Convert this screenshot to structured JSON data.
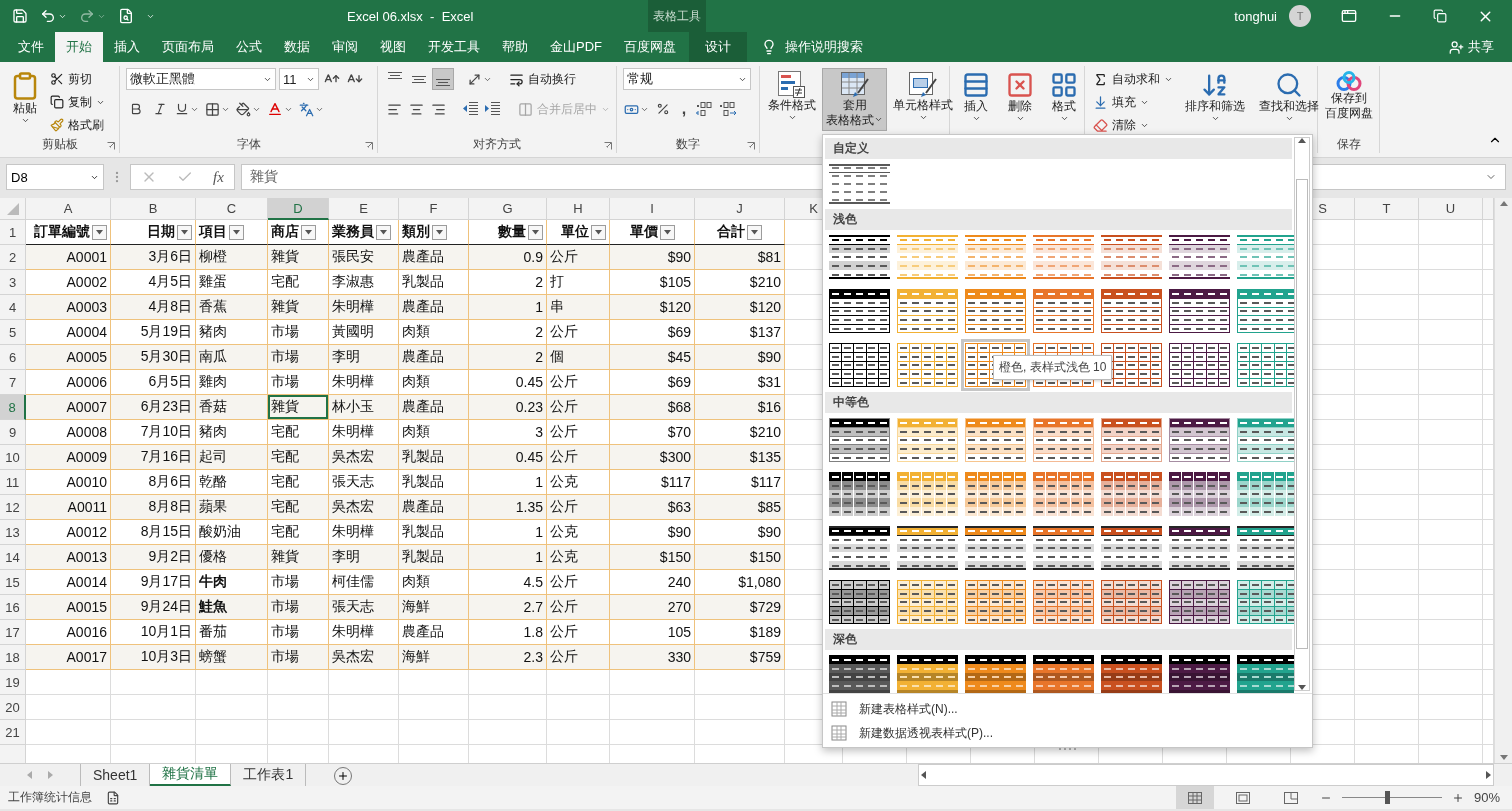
{
  "title_bar": {
    "title": "Excel 06.xlsx  -  Excel",
    "context_label": "表格工具",
    "user": "tonghui",
    "avatar_initial": "T"
  },
  "ribbon_tabs": [
    {
      "label": "文件",
      "kind": "normal",
      "selected": false
    },
    {
      "label": "开始",
      "kind": "normal",
      "selected": true
    },
    {
      "label": "插入",
      "kind": "normal",
      "selected": false
    },
    {
      "label": "页面布局",
      "kind": "normal",
      "selected": false
    },
    {
      "label": "公式",
      "kind": "normal",
      "selected": false
    },
    {
      "label": "数据",
      "kind": "normal",
      "selected": false
    },
    {
      "label": "审阅",
      "kind": "normal",
      "selected": false
    },
    {
      "label": "视图",
      "kind": "normal",
      "selected": false
    },
    {
      "label": "开发工具",
      "kind": "normal",
      "selected": false
    },
    {
      "label": "帮助",
      "kind": "normal",
      "selected": false
    },
    {
      "label": "金山PDF",
      "kind": "normal",
      "selected": false
    },
    {
      "label": "百度网盘",
      "kind": "normal",
      "selected": false
    },
    {
      "label": "设计",
      "kind": "context",
      "selected": false
    }
  ],
  "tell_me": "操作说明搜索",
  "share": "共享",
  "ribbon": {
    "clipboard": {
      "label": "剪贴板",
      "paste": "粘贴",
      "cut": "剪切",
      "copy": "复制",
      "format_painter": "格式刷"
    },
    "font": {
      "label": "字体",
      "font_name": "微軟正黑體",
      "font_size": "11"
    },
    "alignment": {
      "label": "对齐方式",
      "valign": [
        {
          "kind": "top",
          "selected": false
        },
        {
          "kind": "middle",
          "selected": false
        },
        {
          "kind": "bottom",
          "selected": true
        }
      ],
      "wrap_text": "自动换行",
      "merge": "合并后居中",
      "merge_disabled": true
    },
    "number": {
      "label": "数字",
      "format": "常规",
      "comma": ","
    },
    "styles": {
      "conditional": "条件格式",
      "table_format": [
        "套用",
        "表格格式"
      ],
      "table_format_open": true,
      "cell_styles": "单元格样式"
    },
    "cells": {
      "insert": "插入",
      "delete": "删除",
      "format": "格式"
    },
    "editing": {
      "autosum": "自动求和",
      "fill": "填充",
      "clear": "清除",
      "sort": "排序和筛选",
      "find": "查找和选择"
    },
    "save": {
      "button": [
        "保存到",
        "百度网盘"
      ],
      "label": "保存"
    }
  },
  "formula_bar": {
    "name_box": "D8",
    "fx": "fx",
    "content": "雜貨"
  },
  "sheet": {
    "columns": [
      {
        "letter": "A",
        "selected": false
      },
      {
        "letter": "B",
        "selected": false
      },
      {
        "letter": "C",
        "selected": false
      },
      {
        "letter": "D",
        "selected": true
      },
      {
        "letter": "E",
        "selected": false
      },
      {
        "letter": "F",
        "selected": false
      },
      {
        "letter": "G",
        "selected": false
      },
      {
        "letter": "H",
        "selected": false
      },
      {
        "letter": "I",
        "selected": false
      },
      {
        "letter": "J",
        "selected": false
      },
      {
        "letter": "K",
        "selected": false
      }
    ],
    "right_columns": [
      "S",
      "T",
      "U"
    ],
    "header_row": {
      "number": "1",
      "cells": [
        "訂單編號",
        "日期",
        "項目",
        "商店",
        "業務員",
        "類別",
        "數量",
        "單位",
        "單價",
        "合計"
      ]
    },
    "rows": [
      {
        "number": "2",
        "selected": false,
        "item_bold": false,
        "cells": [
          "A0001",
          "3月6日",
          "柳橙",
          "雜貨",
          "張民安",
          "農產品",
          "0.9",
          "公斤",
          "$90",
          "$81"
        ]
      },
      {
        "number": "3",
        "selected": false,
        "item_bold": false,
        "cells": [
          "A0002",
          "4月5日",
          "雞蛋",
          "宅配",
          "李淑惠",
          "乳製品",
          "2",
          "打",
          "$105",
          "$210"
        ]
      },
      {
        "number": "4",
        "selected": false,
        "item_bold": false,
        "cells": [
          "A0003",
          "4月8日",
          "香蕉",
          "雜貨",
          "朱明樺",
          "農產品",
          "1",
          "串",
          "$120",
          "$120"
        ]
      },
      {
        "number": "5",
        "selected": false,
        "item_bold": false,
        "cells": [
          "A0004",
          "5月19日",
          "豬肉",
          "市場",
          "黃國明",
          "肉類",
          "2",
          "公斤",
          "$69",
          "$137"
        ]
      },
      {
        "number": "6",
        "selected": false,
        "item_bold": false,
        "cells": [
          "A0005",
          "5月30日",
          "南瓜",
          "市場",
          "李明",
          "農產品",
          "2",
          "個",
          "$45",
          "$90"
        ]
      },
      {
        "number": "7",
        "selected": false,
        "item_bold": false,
        "cells": [
          "A0006",
          "6月5日",
          "雞肉",
          "市場",
          "朱明樺",
          "肉類",
          "0.45",
          "公斤",
          "$69",
          "$31"
        ]
      },
      {
        "number": "8",
        "selected": true,
        "item_bold": false,
        "cells": [
          "A0007",
          "6月23日",
          "香菇",
          "雜貨",
          "林小玉",
          "農產品",
          "0.23",
          "公斤",
          "$68",
          "$16"
        ]
      },
      {
        "number": "9",
        "selected": false,
        "item_bold": false,
        "cells": [
          "A0008",
          "7月10日",
          "豬肉",
          "宅配",
          "朱明樺",
          "肉類",
          "3",
          "公斤",
          "$70",
          "$210"
        ]
      },
      {
        "number": "10",
        "selected": false,
        "item_bold": false,
        "cells": [
          "A0009",
          "7月16日",
          "起司",
          "宅配",
          "吳杰宏",
          "乳製品",
          "0.45",
          "公斤",
          "$300",
          "$135"
        ]
      },
      {
        "number": "11",
        "selected": false,
        "item_bold": false,
        "cells": [
          "A0010",
          "8月6日",
          "乾酪",
          "宅配",
          "張天志",
          "乳製品",
          "1",
          "公克",
          "$117",
          "$117"
        ]
      },
      {
        "number": "12",
        "selected": false,
        "item_bold": false,
        "cells": [
          "A0011",
          "8月8日",
          "蘋果",
          "宅配",
          "吳杰宏",
          "農產品",
          "1.35",
          "公斤",
          "$63",
          "$85"
        ]
      },
      {
        "number": "13",
        "selected": false,
        "item_bold": false,
        "cells": [
          "A0012",
          "8月15日",
          "酸奶油",
          "宅配",
          "朱明樺",
          "乳製品",
          "1",
          "公克",
          "$90",
          "$90"
        ]
      },
      {
        "number": "14",
        "selected": false,
        "item_bold": false,
        "cells": [
          "A0013",
          "9月2日",
          "優格",
          "雜貨",
          "李明",
          "乳製品",
          "1",
          "公克",
          "$150",
          "$150"
        ]
      },
      {
        "number": "15",
        "selected": false,
        "item_bold": true,
        "cells": [
          "A0014",
          "9月17日",
          "牛肉",
          "市場",
          "柯佳儒",
          "肉類",
          "4.5",
          "公斤",
          "240",
          "$1,080"
        ]
      },
      {
        "number": "16",
        "selected": false,
        "item_bold": true,
        "cells": [
          "A0015",
          "9月24日",
          "鮭魚",
          "市場",
          "張天志",
          "海鮮",
          "2.7",
          "公斤",
          "270",
          "$729"
        ]
      },
      {
        "number": "17",
        "selected": false,
        "item_bold": false,
        "cells": [
          "A0016",
          "10月1日",
          "番茄",
          "市場",
          "朱明樺",
          "農產品",
          "1.8",
          "公斤",
          "105",
          "$189"
        ]
      },
      {
        "number": "18",
        "selected": false,
        "item_bold": false,
        "cells": [
          "A0017",
          "10月3日",
          "螃蟹",
          "市場",
          "吳杰宏",
          "海鮮",
          "2.3",
          "公斤",
          "330",
          "$759"
        ]
      }
    ],
    "empty_rows": [
      "19",
      "20",
      "21"
    ]
  },
  "gallery": {
    "sections": [
      {
        "title": "自定义",
        "rows": [
          {
            "kind": "custom",
            "thumbs": [
              {
                "color": "#7f7f7f",
                "hovered": false
              }
            ]
          }
        ]
      },
      {
        "title": "浅色",
        "rows": [
          {
            "kind": "light-lines",
            "thumbs": [
              {
                "color": "#000000",
                "hovered": false
              },
              {
                "color": "#f2b134",
                "hovered": false
              },
              {
                "color": "#ee8a1c",
                "hovered": false
              },
              {
                "color": "#e8752a",
                "hovered": false
              },
              {
                "color": "#c9501f",
                "hovered": false
              },
              {
                "color": "#4c1a44",
                "hovered": false
              },
              {
                "color": "#22a38e",
                "hovered": false
              }
            ]
          },
          {
            "kind": "light-header",
            "thumbs": [
              {
                "color": "#000000",
                "hovered": false
              },
              {
                "color": "#f2b134",
                "hovered": false
              },
              {
                "color": "#ee8a1c",
                "hovered": false
              },
              {
                "color": "#e8752a",
                "hovered": false
              },
              {
                "color": "#c9501f",
                "hovered": false
              },
              {
                "color": "#4c1a44",
                "hovered": false
              },
              {
                "color": "#22a38e",
                "hovered": false
              }
            ]
          },
          {
            "kind": "light-grid",
            "thumbs": [
              {
                "color": "#000000",
                "hovered": false
              },
              {
                "color": "#f2b134",
                "hovered": false
              },
              {
                "color": "#ee8a1c",
                "hovered": true
              },
              {
                "color": "#e8752a",
                "hovered": false
              },
              {
                "color": "#c9501f",
                "hovered": false
              },
              {
                "color": "#4c1a44",
                "hovered": false
              },
              {
                "color": "#22a38e",
                "hovered": false
              }
            ]
          }
        ]
      },
      {
        "title": "中等色",
        "rows": [
          {
            "kind": "medium-banded",
            "thumbs": [
              {
                "color": "#000000",
                "hovered": false
              },
              {
                "color": "#f2b134",
                "hovered": false
              },
              {
                "color": "#ee8a1c",
                "hovered": false
              },
              {
                "color": "#e8752a",
                "hovered": false
              },
              {
                "color": "#c9501f",
                "hovered": false
              },
              {
                "color": "#4c1a44",
                "hovered": false
              },
              {
                "color": "#22a38e",
                "hovered": false
              }
            ]
          },
          {
            "kind": "medium-grid-header",
            "thumbs": [
              {
                "color": "#000000",
                "hovered": false
              },
              {
                "color": "#f2b134",
                "hovered": false
              },
              {
                "color": "#ee8a1c",
                "hovered": false
              },
              {
                "color": "#e8752a",
                "hovered": false
              },
              {
                "color": "#c9501f",
                "hovered": false
              },
              {
                "color": "#4c1a44",
                "hovered": false
              },
              {
                "color": "#22a38e",
                "hovered": false
              }
            ]
          },
          {
            "kind": "medium-gray",
            "thumbs": [
              {
                "color": "#000000",
                "hovered": false
              },
              {
                "color": "#f2b134",
                "hovered": false
              },
              {
                "color": "#ee8a1c",
                "hovered": false
              },
              {
                "color": "#e8752a",
                "hovered": false
              },
              {
                "color": "#c9501f",
                "hovered": false
              },
              {
                "color": "#4c1a44",
                "hovered": false
              },
              {
                "color": "#22a38e",
                "hovered": false
              }
            ]
          },
          {
            "kind": "medium-grid",
            "thumbs": [
              {
                "color": "#000000",
                "hovered": false
              },
              {
                "color": "#f2b134",
                "hovered": false
              },
              {
                "color": "#ee8a1c",
                "hovered": false
              },
              {
                "color": "#e8752a",
                "hovered": false
              },
              {
                "color": "#c9501f",
                "hovered": false
              },
              {
                "color": "#4c1a44",
                "hovered": false
              },
              {
                "color": "#22a38e",
                "hovered": false
              }
            ]
          }
        ]
      },
      {
        "title": "深色",
        "rows": [
          {
            "kind": "dark",
            "thumbs": [
              {
                "color": "#595959",
                "hovered": false
              },
              {
                "color": "#f2b134",
                "hovered": false
              },
              {
                "color": "#ee8a1c",
                "hovered": false
              },
              {
                "color": "#e8752a",
                "hovered": false
              },
              {
                "color": "#c9501f",
                "hovered": false
              },
              {
                "color": "#4c1a44",
                "hovered": false
              },
              {
                "color": "#22a38e",
                "hovered": false
              }
            ]
          }
        ]
      }
    ],
    "tooltip": "橙色, 表样式浅色 10",
    "actions": [
      "新建表格样式(N)...",
      "新建数据透视表样式(P)..."
    ]
  },
  "sheet_tabs": [
    {
      "label": "Sheet1",
      "selected": false
    },
    {
      "label": "雜貨清單",
      "selected": true
    },
    {
      "label": "工作表1",
      "selected": false
    }
  ],
  "status_bar": {
    "text": "工作簿统计信息",
    "views": [
      {
        "kind": "normal",
        "selected": true
      },
      {
        "kind": "page-layout",
        "selected": false
      },
      {
        "kind": "page-break",
        "selected": false
      }
    ],
    "zoom_slider": {
      "level": 0.45
    },
    "zoom": "90%"
  }
}
